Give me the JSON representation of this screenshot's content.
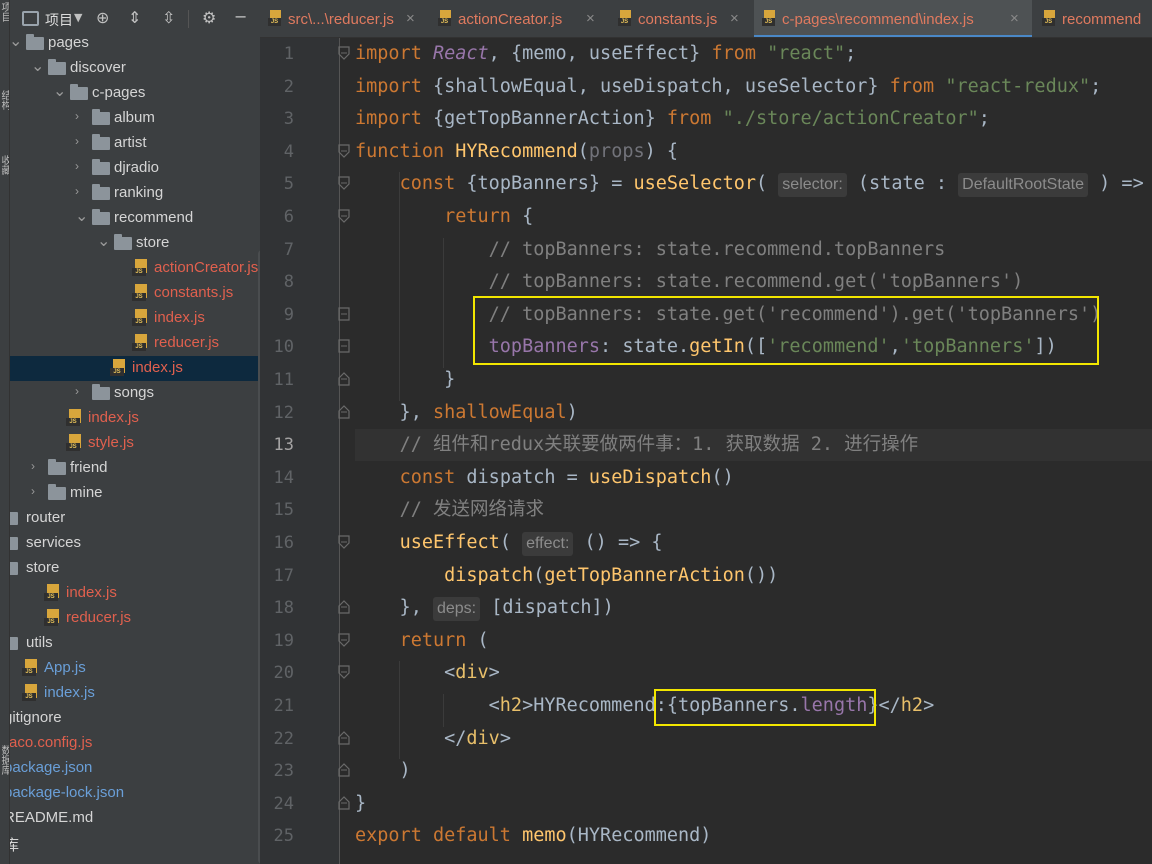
{
  "project_panel": {
    "title": "项目",
    "strip_labels": [
      "项目",
      "结构",
      "收藏",
      "数据库"
    ],
    "tree": [
      {
        "label": "pages",
        "type": "folder",
        "depth": 0,
        "open": true,
        "color": "normal"
      },
      {
        "label": "discover",
        "type": "folder",
        "depth": 1,
        "open": true,
        "color": "normal"
      },
      {
        "label": "c-pages",
        "type": "folder",
        "depth": 2,
        "open": true,
        "color": "normal"
      },
      {
        "label": "album",
        "type": "folder",
        "depth": 3,
        "open": false,
        "color": "normal"
      },
      {
        "label": "artist",
        "type": "folder",
        "depth": 3,
        "open": false,
        "color": "normal"
      },
      {
        "label": "djradio",
        "type": "folder",
        "depth": 3,
        "open": false,
        "color": "normal"
      },
      {
        "label": "ranking",
        "type": "folder",
        "depth": 3,
        "open": false,
        "color": "normal"
      },
      {
        "label": "recommend",
        "type": "folder",
        "depth": 3,
        "open": true,
        "color": "normal"
      },
      {
        "label": "store",
        "type": "folder",
        "depth": 4,
        "open": true,
        "color": "normal"
      },
      {
        "label": "actionCreator.js",
        "type": "js",
        "depth": 5,
        "color": "red"
      },
      {
        "label": "constants.js",
        "type": "js",
        "depth": 5,
        "color": "red"
      },
      {
        "label": "index.js",
        "type": "js",
        "depth": 5,
        "color": "red"
      },
      {
        "label": "reducer.js",
        "type": "js",
        "depth": 5,
        "color": "red"
      },
      {
        "label": "index.js",
        "type": "js",
        "depth": 4,
        "color": "red",
        "selected": true
      },
      {
        "label": "songs",
        "type": "folder",
        "depth": 3,
        "open": false,
        "color": "normal"
      },
      {
        "label": "index.js",
        "type": "js",
        "depth": 2,
        "color": "red"
      },
      {
        "label": "style.js",
        "type": "js",
        "depth": 2,
        "color": "red"
      },
      {
        "label": "friend",
        "type": "folder",
        "depth": 1,
        "open": false,
        "color": "normal"
      },
      {
        "label": "mine",
        "type": "folder",
        "depth": 1,
        "open": false,
        "color": "normal"
      },
      {
        "label": "router",
        "type": "folder",
        "depth": 0,
        "color": "normal"
      },
      {
        "label": "services",
        "type": "folder",
        "depth": 0,
        "color": "normal"
      },
      {
        "label": "store",
        "type": "folder",
        "depth": 0,
        "color": "normal"
      },
      {
        "label": "index.js",
        "type": "js",
        "depth": 1,
        "color": "red"
      },
      {
        "label": "reducer.js",
        "type": "js",
        "depth": 1,
        "color": "red"
      },
      {
        "label": "utils",
        "type": "folder",
        "depth": 0,
        "color": "normal"
      },
      {
        "label": "App.js",
        "type": "js",
        "depth": 0,
        "color": "blue"
      },
      {
        "label": "index.js",
        "type": "js",
        "depth": 0,
        "color": "blue"
      },
      {
        "label": "gitignore",
        "type": "file",
        "depth": -1,
        "color": "normal"
      },
      {
        "label": "raco.config.js",
        "type": "file",
        "depth": -1,
        "color": "red"
      },
      {
        "label": "package.json",
        "type": "file",
        "depth": -1,
        "color": "blue"
      },
      {
        "label": "package-lock.json",
        "type": "file",
        "depth": -1,
        "color": "blue"
      },
      {
        "label": "README.md",
        "type": "file",
        "depth": -1,
        "color": "normal"
      },
      {
        "label": "库",
        "type": "file",
        "depth": -1,
        "color": "normal"
      }
    ]
  },
  "tabs": [
    {
      "label": "src\\...\\reducer.js",
      "active": false
    },
    {
      "label": "actionCreator.js",
      "active": false
    },
    {
      "label": "constants.js",
      "active": false
    },
    {
      "label": "c-pages\\recommend\\index.js",
      "active": true
    },
    {
      "label": "recommend",
      "active": false
    }
  ],
  "editor": {
    "current_line": 13,
    "line_numbers": [
      "1",
      "2",
      "3",
      "4",
      "5",
      "6",
      "7",
      "8",
      "9",
      "10",
      "11",
      "12",
      "13",
      "14",
      "15",
      "16",
      "17",
      "18",
      "19",
      "20",
      "21",
      "22",
      "23",
      "24",
      "25"
    ],
    "code_lines": [
      "import React, {memo, useEffect} from \"react\";",
      "import {shallowEqual, useDispatch, useSelector} from \"react-redux\";",
      "import {getTopBannerAction} from \"./store/actionCreator\";",
      "function HYRecommend(props) {",
      "    const {topBanners} = useSelector( selector: (state : DefaultRootState ) => {",
      "        return {",
      "            // topBanners: state.recommend.topBanners",
      "            // topBanners: state.recommend.get('topBanners')",
      "            // topBanners: state.get('recommend').get('topBanners')",
      "            topBanners: state.getIn(['recommend','topBanners'])",
      "        }",
      "    }, shallowEqual)",
      "    // 组件和redux关联要做两件事：1. 获取数据 2. 进行操作",
      "    const dispatch = useDispatch()",
      "    // 发送网络请求",
      "    useEffect( effect: () => {",
      "        dispatch(getTopBannerAction())",
      "    }, deps: [dispatch])",
      "    return (",
      "        <div>",
      "            <h2>HYRecommend:{topBanners.length}</h2>",
      "        </div>",
      "    )",
      "}",
      "export default memo(HYRecommend)"
    ]
  },
  "theme": {
    "keyword": "#cc7832",
    "string": "#6a8759",
    "function": "#ffc66d",
    "comment": "#808080",
    "property": "#9876aa",
    "highlight_box": "#f2e600"
  }
}
